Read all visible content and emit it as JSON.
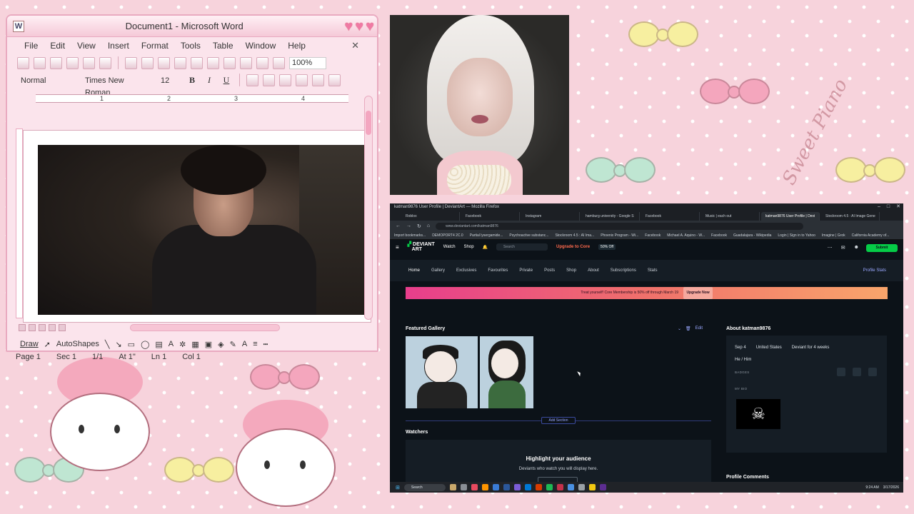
{
  "desktop": {
    "wallpaper_text": "Sweet Piano"
  },
  "word": {
    "title": "Document1 - Microsoft Word",
    "menu": [
      "File",
      "Edit",
      "View",
      "Insert",
      "Format",
      "Tools",
      "Table",
      "Window",
      "Help"
    ],
    "zoom": "100%",
    "style": "Normal",
    "font": "Times New Roman",
    "size": "12",
    "bold": "B",
    "italic": "I",
    "underline": "U",
    "ruler_marks": [
      "1",
      "2",
      "3",
      "4"
    ],
    "draw_label": "Draw",
    "autoshapes_label": "AutoShapes",
    "status": {
      "page": "Page 1",
      "sec": "Sec 1",
      "pages": "1/1",
      "at": "At 1\"",
      "ln": "Ln 1",
      "col": "Col 1"
    }
  },
  "browser": {
    "window_title": "katman9876 User Profile | DeviantArt — Mozilla Firefox",
    "tabs": [
      "Roblox",
      "Facebook",
      "Instagram",
      "hamburg university - Google S",
      "Facebook",
      "Music | each out",
      "katman9876 User Profile | Devi",
      "Stockroom 4.5 : AI Image Gene"
    ],
    "url": "www.deviantart.com/katman9876",
    "bookmarks": [
      "Import bookmarks...",
      "DEMOPORT4 2C.0",
      "Partial lysergamide...",
      "Psychoactive substanc...",
      "Stockroom 4.5 : AI Ima...",
      "Phoenix Program - Wi...",
      "Facebook",
      "Michael A. Aquino - W...",
      "Facebook",
      "Guadalajara - Wikipedia",
      "Login | Sign in to Yahoo",
      "Imagine | Grok",
      "California Academy of..."
    ],
    "da": {
      "logo_top": "DEVIANT",
      "logo_bottom": "ART",
      "watch": "Watch",
      "shop": "Shop",
      "search_placeholder": "Search",
      "upgrade": "Upgrade to Core",
      "discount": "50% Off",
      "submit": "Submit",
      "profile_tabs": [
        "Home",
        "Gallery",
        "Exclusives",
        "Favourites",
        "Private",
        "Posts",
        "Shop",
        "About",
        "Subscriptions",
        "Stats"
      ],
      "profile_stats": "Profile Stats",
      "promo_text": "Treat yourself! Core Membership is 50% off through March 19",
      "promo_cta": "Upgrade Now",
      "featured_title": "Featured Gallery",
      "edit": "Edit",
      "add_section": "Add Section",
      "watchers_title": "Watchers",
      "watchers_heading": "Highlight your audience",
      "watchers_sub": "Deviants who watch you will display here.",
      "about_title": "About katman9876",
      "about_date": "Sep 4",
      "about_country": "United States",
      "about_age": "Deviant for 4 weeks",
      "about_pronouns": "He / Him",
      "badges_label": "BADGES",
      "bio_label": "MY BIO",
      "profile_comments": "Profile Comments"
    },
    "taskbar": {
      "search": "Search",
      "time": "9:24 AM",
      "date": "3/17/2026"
    }
  }
}
